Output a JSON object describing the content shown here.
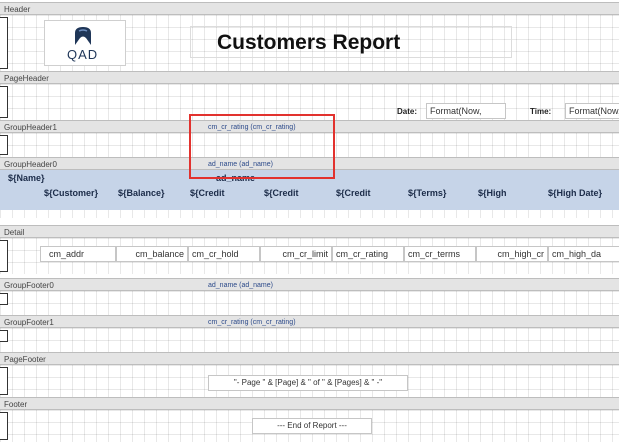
{
  "bands": {
    "header": "Header",
    "page_header": "PageHeader",
    "group_header1": "GroupHeader1",
    "group_header0": "GroupHeader0",
    "detail": "Detail",
    "group_footer0": "GroupFooter0",
    "group_footer1": "GroupFooter1",
    "page_footer": "PageFooter",
    "footer": "Footer"
  },
  "header": {
    "logo_text": "QAD",
    "title": "Customers Report"
  },
  "page_header": {
    "date_label": "Date:",
    "date_value": "Format(Now,",
    "time_label": "Time:",
    "time_value": "Format(Now,"
  },
  "group_header1": {
    "binding": "cm_cr_rating (cm_cr_rating)"
  },
  "group_header0": {
    "binding": "ad_name (ad_name)",
    "name_label": "${Name}",
    "ad_name_label": "ad_name",
    "columns": [
      "${Customer}",
      "${Balance}",
      "${Credit",
      "${Credit",
      "${Credit",
      "${Terms}",
      "${High",
      "${High Date}"
    ]
  },
  "detail": {
    "fields": [
      "cm_addr",
      "cm_balance",
      "cm_cr_hold",
      "cm_cr_limit",
      "cm_cr_rating",
      "cm_cr_terms",
      "cm_high_cr",
      "cm_high_da"
    ]
  },
  "group_footer0": {
    "binding": "ad_name (ad_name)"
  },
  "group_footer1": {
    "binding": "cm_cr_rating (cm_cr_rating)"
  },
  "page_footer": {
    "expression": "\"- Page \" & [Page] & \" of \" & [Pages] & \" -\""
  },
  "footer": {
    "text": "--- End of Report ---"
  },
  "colors": {
    "highlight": "#e2322e",
    "band_bg": "#e4e4e4",
    "group_header_bg": "#c6d4e8"
  }
}
